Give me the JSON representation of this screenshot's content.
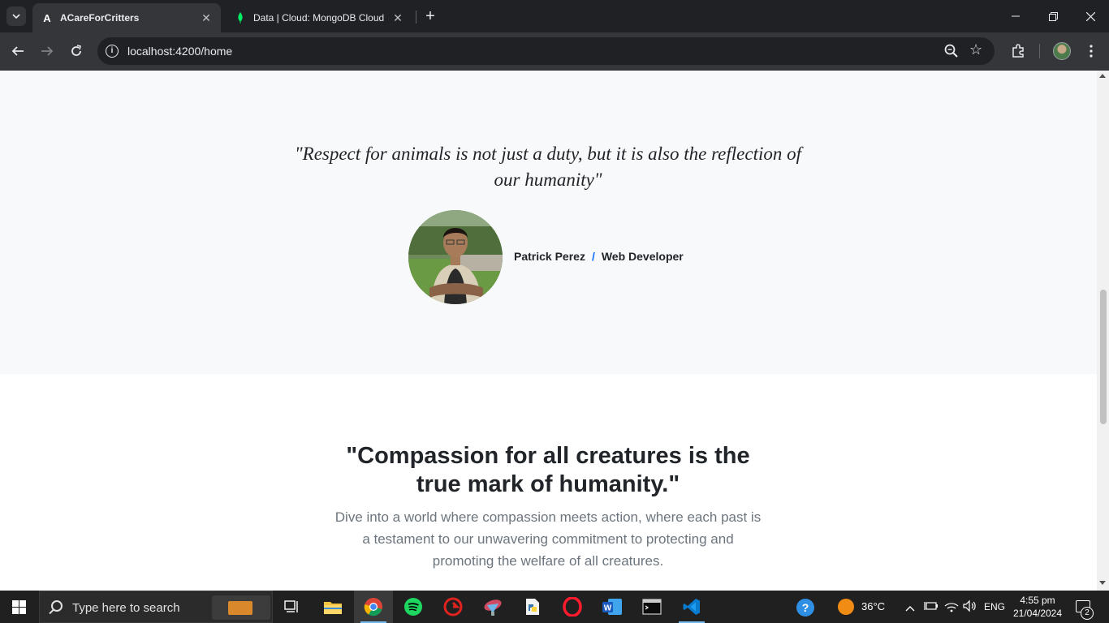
{
  "browser": {
    "tabs": [
      {
        "title": "ACareForCritters",
        "favicon": "angular-icon",
        "active": true
      },
      {
        "title": "Data | Cloud: MongoDB Cloud",
        "favicon": "mongodb-leaf-icon",
        "active": false
      }
    ],
    "address": "localhost:4200/home"
  },
  "page": {
    "testimonial": {
      "quote": "\"Respect for animals is not just a duty, but it is also the reflection of our humanity\"",
      "author_name": "Patrick Perez",
      "separator": "/",
      "author_role": "Web Developer"
    },
    "cta": {
      "title": "\"Compassion for all creatures is the true mark of humanity.\"",
      "text": "Dive into a world where compassion meets action, where each past is a testament to our unwavering commitment to protecting and promoting the welfare of all creatures."
    }
  },
  "taskbar": {
    "search_placeholder": "Type here to search",
    "weather": "36°C",
    "language": "ENG",
    "time": "4:55 pm",
    "date": "21/04/2024",
    "notification_count": "2"
  }
}
